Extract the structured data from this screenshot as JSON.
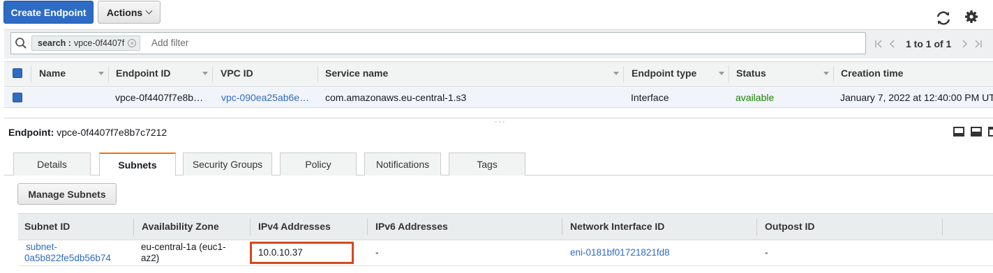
{
  "toolbar": {
    "create_label": "Create Endpoint",
    "actions_label": "Actions"
  },
  "filter": {
    "token_key": "search :",
    "token_value": "vpce-0f4407f",
    "placeholder": "Add filter",
    "pager_text": "1 to 1 of 1"
  },
  "endpoints_table": {
    "headers": [
      "Name",
      "Endpoint ID",
      "VPC ID",
      "Service name",
      "Endpoint type",
      "Status",
      "Creation time"
    ],
    "rows": [
      {
        "name": "",
        "endpoint_id": "vpce-0f4407f7e8b…",
        "vpc_id": "vpc-090ea25ab6e…",
        "service_name": "com.amazonaws.eu-central-1.s3",
        "endpoint_type": "Interface",
        "status": "available",
        "creation_time": "January 7, 2022 at 12:40:00 PM UT"
      }
    ]
  },
  "detail": {
    "label": "Endpoint:",
    "value": "vpce-0f4407f7e8b7c7212",
    "tabs": [
      "Details",
      "Subnets",
      "Security Groups",
      "Policy",
      "Notifications",
      "Tags"
    ],
    "active_tab": "Subnets",
    "manage_label": "Manage Subnets"
  },
  "subnets_table": {
    "headers": [
      "Subnet ID",
      "Availability Zone",
      "IPv4 Addresses",
      "IPv6 Addresses",
      "Network Interface ID",
      "Outpost ID"
    ],
    "rows": [
      {
        "subnet_id_line1": "subnet-",
        "subnet_id_line2": "0a5b822fe5db56b74",
        "az_line1": "eu-central-1a (euc1-",
        "az_line2": "az2)",
        "ipv4": "10.0.10.37",
        "ipv6": "-",
        "eni": "eni-0181bf01721821fd8",
        "outpost": "-"
      }
    ]
  },
  "colors": {
    "primary": "#2e6bc4",
    "available": "#1d8102",
    "active_tab_accent": "#ec7211",
    "highlight": "#d4481f"
  },
  "icons": [
    "search-icon",
    "refresh-icon",
    "gear-icon",
    "first-page-icon",
    "prev-page-icon",
    "next-page-icon",
    "last-page-icon",
    "chevron-down-icon",
    "clear-token-icon"
  ]
}
